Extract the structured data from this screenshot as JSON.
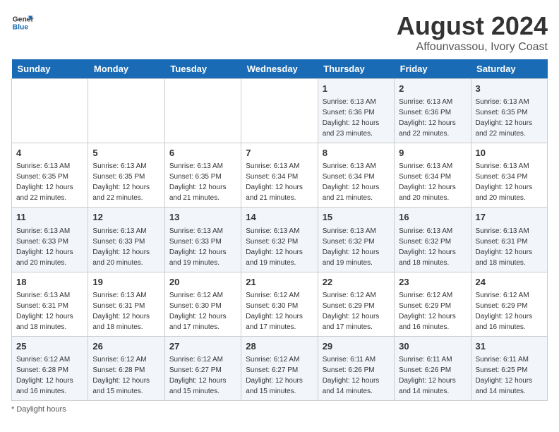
{
  "logo": {
    "line1": "General",
    "line2": "Blue"
  },
  "title": "August 2024",
  "subtitle": "Affounvassou, Ivory Coast",
  "days_of_week": [
    "Sunday",
    "Monday",
    "Tuesday",
    "Wednesday",
    "Thursday",
    "Friday",
    "Saturday"
  ],
  "weeks": [
    [
      {
        "day": "",
        "info": ""
      },
      {
        "day": "",
        "info": ""
      },
      {
        "day": "",
        "info": ""
      },
      {
        "day": "",
        "info": ""
      },
      {
        "day": "1",
        "info": "Sunrise: 6:13 AM\nSunset: 6:36 PM\nDaylight: 12 hours\nand 23 minutes."
      },
      {
        "day": "2",
        "info": "Sunrise: 6:13 AM\nSunset: 6:36 PM\nDaylight: 12 hours\nand 22 minutes."
      },
      {
        "day": "3",
        "info": "Sunrise: 6:13 AM\nSunset: 6:35 PM\nDaylight: 12 hours\nand 22 minutes."
      }
    ],
    [
      {
        "day": "4",
        "info": "Sunrise: 6:13 AM\nSunset: 6:35 PM\nDaylight: 12 hours\nand 22 minutes."
      },
      {
        "day": "5",
        "info": "Sunrise: 6:13 AM\nSunset: 6:35 PM\nDaylight: 12 hours\nand 22 minutes."
      },
      {
        "day": "6",
        "info": "Sunrise: 6:13 AM\nSunset: 6:35 PM\nDaylight: 12 hours\nand 21 minutes."
      },
      {
        "day": "7",
        "info": "Sunrise: 6:13 AM\nSunset: 6:34 PM\nDaylight: 12 hours\nand 21 minutes."
      },
      {
        "day": "8",
        "info": "Sunrise: 6:13 AM\nSunset: 6:34 PM\nDaylight: 12 hours\nand 21 minutes."
      },
      {
        "day": "9",
        "info": "Sunrise: 6:13 AM\nSunset: 6:34 PM\nDaylight: 12 hours\nand 20 minutes."
      },
      {
        "day": "10",
        "info": "Sunrise: 6:13 AM\nSunset: 6:34 PM\nDaylight: 12 hours\nand 20 minutes."
      }
    ],
    [
      {
        "day": "11",
        "info": "Sunrise: 6:13 AM\nSunset: 6:33 PM\nDaylight: 12 hours\nand 20 minutes."
      },
      {
        "day": "12",
        "info": "Sunrise: 6:13 AM\nSunset: 6:33 PM\nDaylight: 12 hours\nand 20 minutes."
      },
      {
        "day": "13",
        "info": "Sunrise: 6:13 AM\nSunset: 6:33 PM\nDaylight: 12 hours\nand 19 minutes."
      },
      {
        "day": "14",
        "info": "Sunrise: 6:13 AM\nSunset: 6:32 PM\nDaylight: 12 hours\nand 19 minutes."
      },
      {
        "day": "15",
        "info": "Sunrise: 6:13 AM\nSunset: 6:32 PM\nDaylight: 12 hours\nand 19 minutes."
      },
      {
        "day": "16",
        "info": "Sunrise: 6:13 AM\nSunset: 6:32 PM\nDaylight: 12 hours\nand 18 minutes."
      },
      {
        "day": "17",
        "info": "Sunrise: 6:13 AM\nSunset: 6:31 PM\nDaylight: 12 hours\nand 18 minutes."
      }
    ],
    [
      {
        "day": "18",
        "info": "Sunrise: 6:13 AM\nSunset: 6:31 PM\nDaylight: 12 hours\nand 18 minutes."
      },
      {
        "day": "19",
        "info": "Sunrise: 6:13 AM\nSunset: 6:31 PM\nDaylight: 12 hours\nand 18 minutes."
      },
      {
        "day": "20",
        "info": "Sunrise: 6:12 AM\nSunset: 6:30 PM\nDaylight: 12 hours\nand 17 minutes."
      },
      {
        "day": "21",
        "info": "Sunrise: 6:12 AM\nSunset: 6:30 PM\nDaylight: 12 hours\nand 17 minutes."
      },
      {
        "day": "22",
        "info": "Sunrise: 6:12 AM\nSunset: 6:29 PM\nDaylight: 12 hours\nand 17 minutes."
      },
      {
        "day": "23",
        "info": "Sunrise: 6:12 AM\nSunset: 6:29 PM\nDaylight: 12 hours\nand 16 minutes."
      },
      {
        "day": "24",
        "info": "Sunrise: 6:12 AM\nSunset: 6:29 PM\nDaylight: 12 hours\nand 16 minutes."
      }
    ],
    [
      {
        "day": "25",
        "info": "Sunrise: 6:12 AM\nSunset: 6:28 PM\nDaylight: 12 hours\nand 16 minutes."
      },
      {
        "day": "26",
        "info": "Sunrise: 6:12 AM\nSunset: 6:28 PM\nDaylight: 12 hours\nand 15 minutes."
      },
      {
        "day": "27",
        "info": "Sunrise: 6:12 AM\nSunset: 6:27 PM\nDaylight: 12 hours\nand 15 minutes."
      },
      {
        "day": "28",
        "info": "Sunrise: 6:12 AM\nSunset: 6:27 PM\nDaylight: 12 hours\nand 15 minutes."
      },
      {
        "day": "29",
        "info": "Sunrise: 6:11 AM\nSunset: 6:26 PM\nDaylight: 12 hours\nand 14 minutes."
      },
      {
        "day": "30",
        "info": "Sunrise: 6:11 AM\nSunset: 6:26 PM\nDaylight: 12 hours\nand 14 minutes."
      },
      {
        "day": "31",
        "info": "Sunrise: 6:11 AM\nSunset: 6:25 PM\nDaylight: 12 hours\nand 14 minutes."
      }
    ]
  ],
  "footer": "Daylight hours"
}
